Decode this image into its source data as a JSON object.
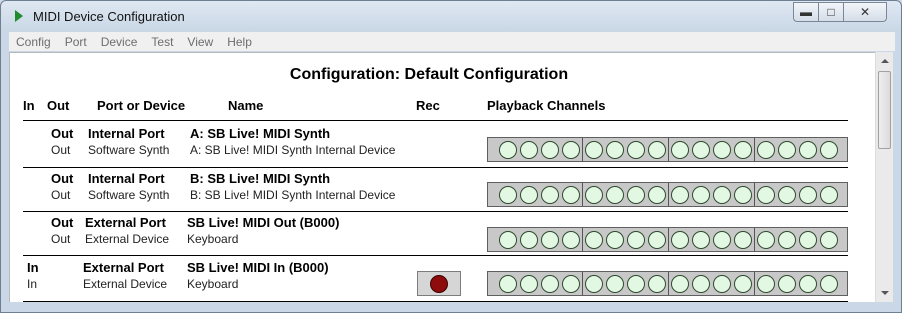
{
  "window": {
    "title": "MIDI Device Configuration"
  },
  "menu": [
    "Config",
    "Port",
    "Device",
    "Test",
    "View",
    "Help"
  ],
  "heading": "Configuration: Default Configuration",
  "columns": {
    "in": "In",
    "out": "Out",
    "port": "Port or Device",
    "name": "Name",
    "rec": "Rec",
    "playback": "Playback Channels"
  },
  "rows": [
    {
      "dir": "Out",
      "port_type": "Internal Port",
      "port_name": "A: SB Live! MIDI Synth",
      "dir2": "Out",
      "device_type": "Software Synth",
      "device_name": "A: SB Live! MIDI Synth Internal Device",
      "rec": false
    },
    {
      "dir": "Out",
      "port_type": "Internal Port",
      "port_name": "B: SB Live! MIDI Synth",
      "dir2": "Out",
      "device_type": "Software Synth",
      "device_name": "B: SB Live! MIDI Synth Internal Device",
      "rec": false
    },
    {
      "dir": "Out",
      "port_type": "External Port",
      "port_name": "SB Live! MIDI Out (B000)",
      "dir2": "Out",
      "device_type": "External Device",
      "device_name": "Keyboard",
      "rec": false
    },
    {
      "dir": "In",
      "port_type": "External Port",
      "port_name": "SB Live! MIDI In (B000)",
      "dir2": "In",
      "device_type": "External Device",
      "device_name": "Keyboard",
      "rec": true
    }
  ],
  "channel_groups": 4,
  "channels_per_group": 4,
  "colors": {
    "led": "#e3f8e3",
    "rec_dot": "#8e0c0c",
    "app_icon": "#1f8c2d"
  }
}
